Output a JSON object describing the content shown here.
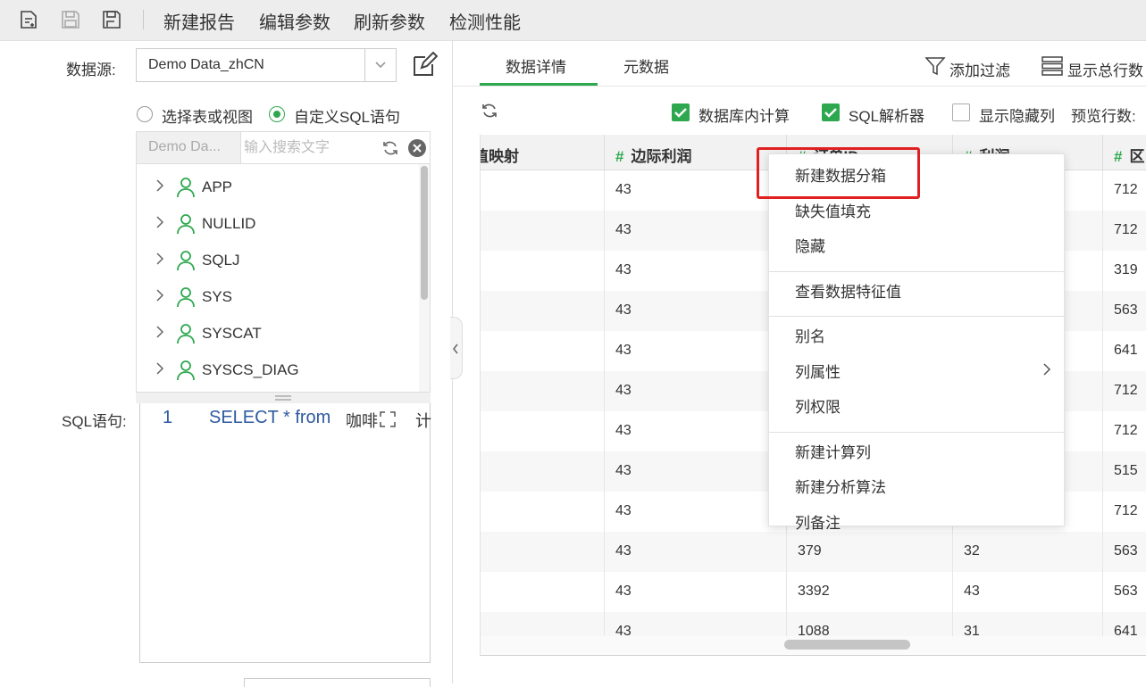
{
  "toolbar": {
    "buttons": [
      "新建报告",
      "编辑参数",
      "刷新参数",
      "检测性能"
    ],
    "icons": [
      "new-file-icon",
      "save-icon",
      "save-as-icon"
    ]
  },
  "datasource": {
    "label": "数据源:",
    "value": "Demo Data_zhCN",
    "mode_table": "选择表或视图",
    "mode_sql": "自定义SQL语句",
    "selected_mode": "sql"
  },
  "tree": {
    "db_label": "Demo Da...",
    "search_placeholder": "输入搜索文字",
    "items": [
      "APP",
      "NULLID",
      "SQLJ",
      "SYS",
      "SYSCAT",
      "SYSCS_DIAG"
    ]
  },
  "sql": {
    "label": "SQL语句:",
    "line_number": "1",
    "keyword_select": "SELECT * from",
    "rest": "咖啡",
    "tail": "计"
  },
  "tabs": {
    "items": [
      "数据详情",
      "元数据"
    ],
    "active": "数据详情",
    "add_filter": "添加过滤",
    "show_total": "显示总行数"
  },
  "options": {
    "db_compute": "数据库内计算",
    "sql_parser": "SQL解析器",
    "show_hidden": "显示隐藏列",
    "preview_rows": "预览行数:",
    "db_compute_checked": true,
    "sql_parser_checked": true,
    "show_hidden_checked": false
  },
  "grid": {
    "columns": [
      {
        "hash": "",
        "label": "值映射"
      },
      {
        "hash": "#",
        "label": "边际利润"
      },
      {
        "hash": "#",
        "label": "订单ID"
      },
      {
        "hash": "#",
        "label": "利润"
      },
      {
        "hash": "#",
        "label": "区"
      }
    ],
    "rows": [
      [
        "",
        "43",
        "",
        "",
        "712"
      ],
      [
        "",
        "43",
        "",
        "",
        "712"
      ],
      [
        "",
        "43",
        "",
        "",
        "319"
      ],
      [
        "",
        "43",
        "",
        "",
        "563"
      ],
      [
        "",
        "43",
        "",
        "",
        "641"
      ],
      [
        "",
        "43",
        "",
        "",
        "712"
      ],
      [
        "",
        "43",
        "",
        "",
        "712"
      ],
      [
        "",
        "43",
        "",
        "",
        "515"
      ],
      [
        "",
        "43",
        "",
        "",
        "712"
      ],
      [
        "",
        "43",
        "379",
        "32",
        "563"
      ],
      [
        "",
        "43",
        "3392",
        "43",
        "563"
      ],
      [
        "",
        "43",
        "1088",
        "31",
        "641"
      ]
    ]
  },
  "context_menu": {
    "groups": [
      [
        "新建数据分箱",
        "缺失值填充",
        "隐藏"
      ],
      [
        "查看数据特征值"
      ],
      [
        "别名",
        "列属性",
        "列权限"
      ],
      [
        "新建计算列",
        "新建分析算法",
        "列备注"
      ]
    ],
    "highlighted": "新建数据分箱",
    "highlight_color": "#e02020"
  },
  "colors": {
    "accent": "#2ea84f",
    "toolbar_bg": "#ededed"
  }
}
